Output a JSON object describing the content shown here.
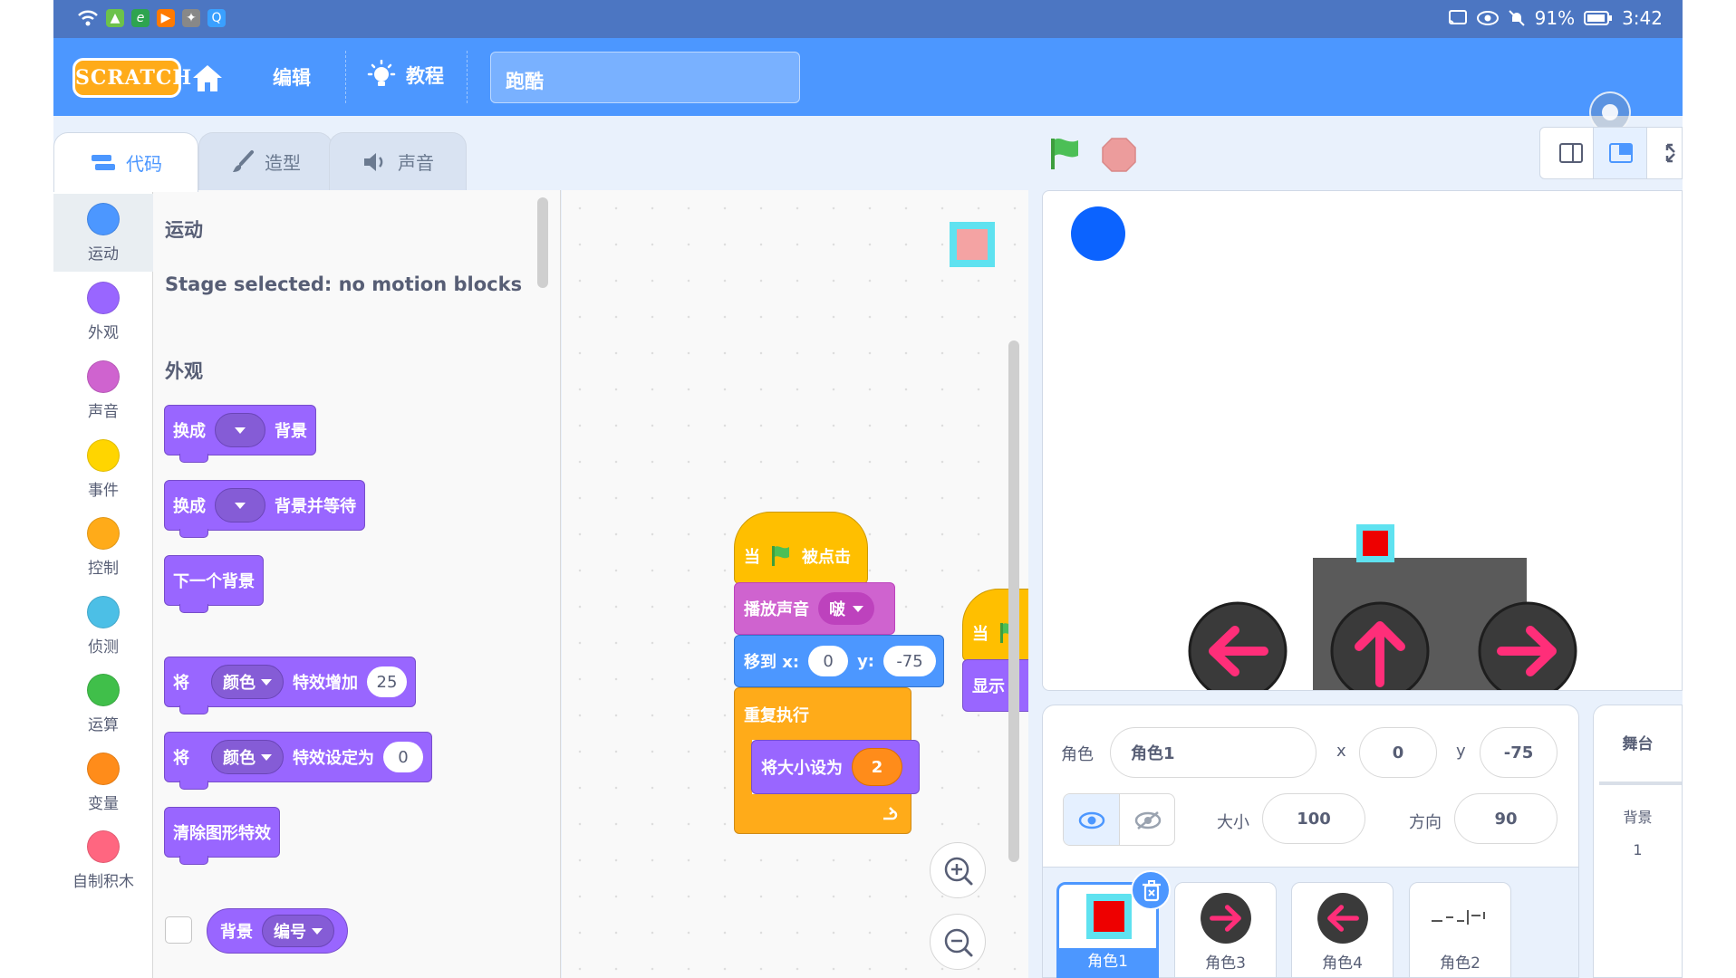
{
  "status_bar": {
    "battery": "91%",
    "time": "3:42"
  },
  "menu": {
    "logo": "SCRATCH",
    "edit": "编辑",
    "tutorials": "教程",
    "project_title": "跑酷"
  },
  "tabs": {
    "code": "代码",
    "costumes": "造型",
    "sounds": "声音"
  },
  "categories": [
    {
      "label": "运动",
      "color": "#4c97ff"
    },
    {
      "label": "外观",
      "color": "#9966ff"
    },
    {
      "label": "声音",
      "color": "#cf63cf"
    },
    {
      "label": "事件",
      "color": "#ffd500"
    },
    {
      "label": "控制",
      "color": "#ffab19"
    },
    {
      "label": "侦测",
      "color": "#4cbfe6"
    },
    {
      "label": "运算",
      "color": "#40bf4a"
    },
    {
      "label": "变量",
      "color": "#ff8c1a"
    },
    {
      "label": "自制积木",
      "color": "#ff6680"
    }
  ],
  "palette": {
    "motion_heading": "运动",
    "motion_message": "Stage selected: no motion blocks",
    "looks_heading": "外观",
    "blocks": {
      "switch_backdrop": {
        "prefix": "换成",
        "suffix": "背景"
      },
      "switch_backdrop_wait": {
        "prefix": "换成",
        "suffix": "背景并等待"
      },
      "next_backdrop": "下一个背景",
      "change_effect": {
        "prefix": "将",
        "effect": "颜色",
        "mid": "特效增加",
        "value": "25"
      },
      "set_effect": {
        "prefix": "将",
        "effect": "颜色",
        "mid": "特效设定为",
        "value": "0"
      },
      "clear_effects": "清除图形特效",
      "backdrop_reporter": {
        "label": "背景",
        "option": "编号"
      }
    }
  },
  "script": {
    "hat": {
      "prefix": "当",
      "suffix": "被点击"
    },
    "play_sound": {
      "label": "播放声音",
      "sound": "啵"
    },
    "goto": {
      "label": "移到 x:",
      "x": "0",
      "ylabel": "y:",
      "y": "-75"
    },
    "forever": "重复执行",
    "set_size": {
      "label": "将大小设为",
      "value": "2"
    },
    "partial_hat": "当",
    "partial_show": "显示"
  },
  "sprite_info": {
    "sprite_label": "角色",
    "sprite_name": "角色1",
    "x_label": "x",
    "x_value": "0",
    "y_label": "y",
    "y_value": "-75",
    "size_label": "大小",
    "size_value": "100",
    "direction_label": "方向",
    "direction_value": "90"
  },
  "sprites": [
    "角色1",
    "角色3",
    "角色4",
    "角色2"
  ],
  "stage_panel": {
    "title": "舞台",
    "backdrops_label": "背景",
    "backdrops_count": "1"
  }
}
